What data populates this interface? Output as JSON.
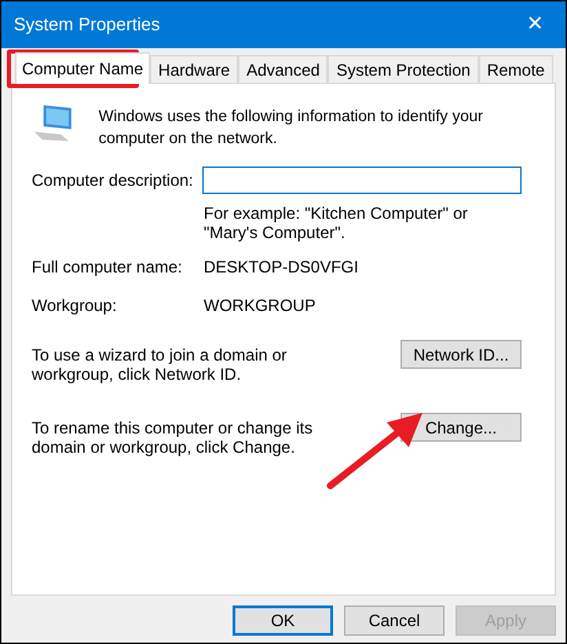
{
  "window": {
    "title": "System Properties",
    "close": "✕"
  },
  "tabs": [
    {
      "label": "Computer Name",
      "selected": true
    },
    {
      "label": "Hardware",
      "selected": false
    },
    {
      "label": "Advanced",
      "selected": false
    },
    {
      "label": "System Protection",
      "selected": false
    },
    {
      "label": "Remote",
      "selected": false
    }
  ],
  "intro": "Windows uses the following information to identify your computer on the network.",
  "description": {
    "label": "Computer description:"
  },
  "example": "For example: \"Kitchen Computer\" or \"Mary's Computer\".",
  "fields": [
    {
      "label": "Full computer name:",
      "value": "DESKTOP-DS0VFGI"
    },
    {
      "label": "Workgroup:",
      "value": "WORKGROUP"
    }
  ],
  "actions": [
    {
      "text": "To use a wizard to join a domain or workgroup, click Network ID.",
      "button": "Network ID..."
    },
    {
      "text": "To rename this computer or change its domain or workgroup, click Change.",
      "button": "Change..."
    }
  ],
  "buttons": [
    {
      "label": "OK",
      "default": true,
      "disabled": false
    },
    {
      "label": "Cancel",
      "default": false,
      "disabled": false
    },
    {
      "label": "Apply",
      "default": false,
      "disabled": true
    }
  ]
}
